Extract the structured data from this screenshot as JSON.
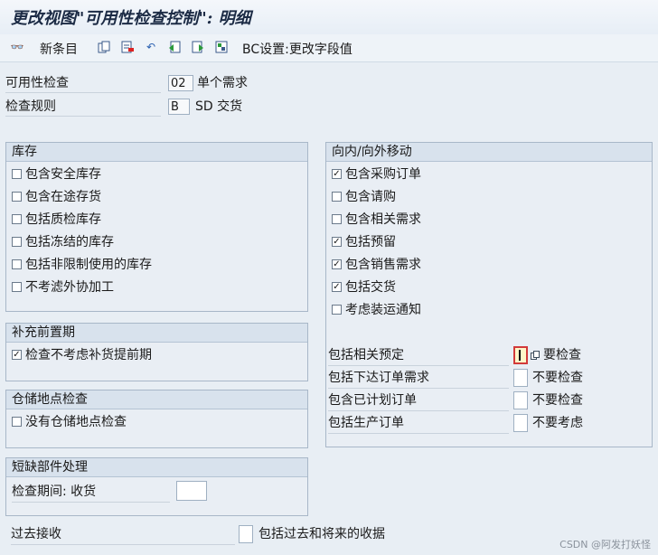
{
  "window": {
    "title": "更改视图\"可用性检查控制\": 明细"
  },
  "toolbar": {
    "new_entries": "新条目",
    "bc_set": "BC设置:更改字段值"
  },
  "fields": {
    "availability_check": {
      "label": "可用性检查",
      "value": "02",
      "desc": "单个需求"
    },
    "checking_rule": {
      "label": "检查规则",
      "value": "B",
      "desc": "SD 交货"
    }
  },
  "stock": {
    "title": "库存",
    "items": [
      {
        "label": "包含安全库存",
        "checked": false
      },
      {
        "label": "包含在途存货",
        "checked": false
      },
      {
        "label": "包括质检库存",
        "checked": false
      },
      {
        "label": "包括冻结的库存",
        "checked": false
      },
      {
        "label": "包括非限制使用的库存",
        "checked": false
      },
      {
        "label": "不考滤外协加工",
        "checked": false
      }
    ]
  },
  "replenishment": {
    "title": "补充前置期",
    "items": [
      {
        "label": "检查不考虑补货提前期",
        "checked": true
      }
    ]
  },
  "storage_location": {
    "title": "仓储地点检查",
    "items": [
      {
        "label": "没有仓储地点检查",
        "checked": false
      }
    ]
  },
  "missing_parts": {
    "title": "短缺部件处理",
    "period_label": "检查期间: 收货",
    "period_value": ""
  },
  "movements": {
    "title": "向内/向外移动",
    "items": [
      {
        "label": "包含采购订单",
        "checked": true
      },
      {
        "label": "包含请购",
        "checked": false
      },
      {
        "label": "包含相关需求",
        "checked": false
      },
      {
        "label": "包括预留",
        "checked": true
      },
      {
        "label": "包含销售需求",
        "checked": true
      },
      {
        "label": "包括交货",
        "checked": true
      },
      {
        "label": "考虑装运通知",
        "checked": false
      }
    ],
    "relations": [
      {
        "label": "包括相关预定",
        "desc": "要检查"
      },
      {
        "label": "包括下达订单需求",
        "desc": "不要检查"
      },
      {
        "label": "包含已计划订单",
        "desc": "不要检查"
      },
      {
        "label": "包括生产订单",
        "desc": "不要考虑"
      }
    ]
  },
  "past_receipts": {
    "label": "过去接收",
    "option": "包括过去和将来的收据"
  },
  "watermark": "CSDN @阿发打妖怪",
  "colors": {
    "background": "#e8eef4",
    "group_header": "#d8e2ed",
    "title_text": "#1c2b45"
  }
}
